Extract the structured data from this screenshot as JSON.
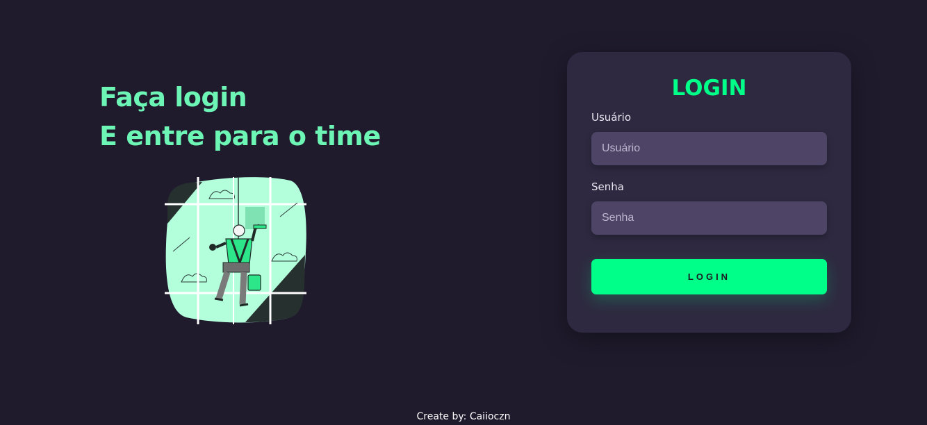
{
  "hero": {
    "line1": "Faça login",
    "line2": "E entre para o time"
  },
  "illustration": {
    "icon": "window-cleaner-illustration",
    "colors": {
      "glass": "#b3ffdc",
      "frame": "#ffffff",
      "dark": "#26302f",
      "accent": "#2ee68a"
    }
  },
  "login_card": {
    "title": "LOGIN",
    "username": {
      "label": "Usuário",
      "placeholder": "Usuário",
      "value": ""
    },
    "password": {
      "label": "Senha",
      "placeholder": "Senha",
      "value": ""
    },
    "submit_label": "LOGIN"
  },
  "footer": {
    "text": "Create by: Caiioczn"
  },
  "colors": {
    "background": "#1f1b2d",
    "card": "#2e2940",
    "input": "#4d4466",
    "accent": "#00ff88",
    "heading": "#6df5b6"
  }
}
